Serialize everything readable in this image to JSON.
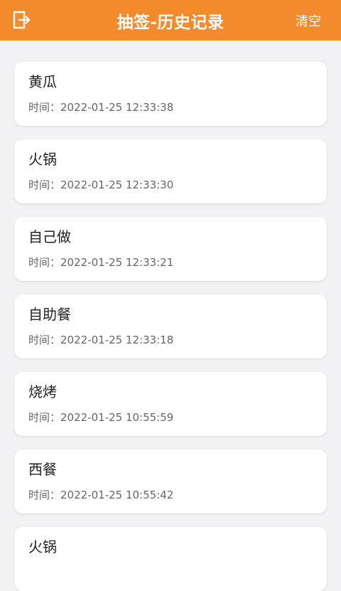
{
  "header": {
    "title": "抽签-历史记录",
    "clear_label": "清空",
    "back_icon": "exit-door-icon",
    "accent_color": "#f38a2c"
  },
  "time_prefix": "时间：",
  "records": [
    {
      "name": "黄瓜",
      "time": "2022-01-25 12:33:38"
    },
    {
      "name": "火锅",
      "time": "2022-01-25 12:33:30"
    },
    {
      "name": "自己做",
      "time": "2022-01-25 12:33:21"
    },
    {
      "name": "自助餐",
      "time": "2022-01-25 12:33:18"
    },
    {
      "name": "烧烤",
      "time": "2022-01-25 10:55:59"
    },
    {
      "name": "西餐",
      "time": "2022-01-25 10:55:42"
    },
    {
      "name": "火锅",
      "time": ""
    }
  ]
}
